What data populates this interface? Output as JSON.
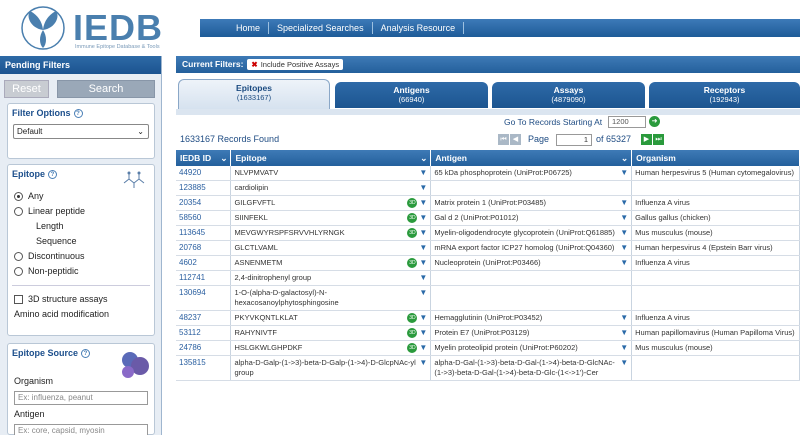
{
  "logo": {
    "title": "IEDB",
    "subtitle": "Immune Epitope Database & Tools"
  },
  "topnav": [
    "Home",
    "Specialized Searches",
    "Analysis Resource"
  ],
  "sidebar": {
    "header": "Pending Filters",
    "reset_label": "Reset",
    "search_label": "Search",
    "filter_options": {
      "title": "Filter Options",
      "selected": "Default"
    },
    "epitope": {
      "title": "Epitope",
      "options": [
        "Any",
        "Linear peptide",
        "Length",
        "Sequence",
        "Discontinuous",
        "Non-peptidic"
      ],
      "structure_checkbox": "3D structure assays",
      "amino_acid": "Amino acid modification"
    },
    "epitope_source": {
      "title": "Epitope Source",
      "organism_label": "Organism",
      "organism_placeholder": "Ex: influenza, peanut",
      "antigen_label": "Antigen",
      "antigen_placeholder": "Ex: core, capsid, myosin"
    }
  },
  "main": {
    "current_filters_label": "Current Filters:",
    "filter_chip": "Include Positive Assays",
    "tabs": [
      {
        "label": "Epitopes",
        "count": "(1633167)"
      },
      {
        "label": "Antigens",
        "count": "(66940)"
      },
      {
        "label": "Assays",
        "count": "(4879090)"
      },
      {
        "label": "Receptors",
        "count": "(192943)"
      }
    ],
    "goto_label": "Go To Records Starting At",
    "goto_value": "1200",
    "records_found": "1633167 Records Found",
    "page_label": "Page",
    "page_value": "1",
    "page_of": "of 65327",
    "columns": [
      "IEDB ID",
      "Epitope",
      "Antigen",
      "Organism"
    ],
    "rows": [
      {
        "id": "44920",
        "epitope": "NLVPMVATV",
        "antigen": "65 kDa phosphoprotein (UniProt:P06725)",
        "organism": "Human herpesvirus 5 (Human cytomegalovirus)",
        "has3d": false
      },
      {
        "id": "123885",
        "epitope": "cardiolipin",
        "antigen": "",
        "organism": "",
        "has3d": false
      },
      {
        "id": "20354",
        "epitope": "GILGFVFTL",
        "antigen": "Matrix protein 1 (UniProt:P03485)",
        "organism": "Influenza A virus",
        "has3d": true
      },
      {
        "id": "58560",
        "epitope": "SIINFEKL",
        "antigen": "Gal d 2 (UniProt:P01012)",
        "organism": "Gallus gallus (chicken)",
        "has3d": true
      },
      {
        "id": "113645",
        "epitope": "MEVGWYRSPFSRVVHLYRNGK",
        "antigen": "Myelin-oligodendrocyte glycoprotein (UniProt:Q61885)",
        "organism": "Mus musculus (mouse)",
        "has3d": true
      },
      {
        "id": "20768",
        "epitope": "GLCTLVAML",
        "antigen": "mRNA export factor ICP27 homolog (UniProt:Q04360)",
        "organism": "Human herpesvirus 4 (Epstein Barr virus)",
        "has3d": false
      },
      {
        "id": "4602",
        "epitope": "ASNENMETM",
        "antigen": "Nucleoprotein (UniProt:P03466)",
        "organism": "Influenza A virus",
        "has3d": true
      },
      {
        "id": "112741",
        "epitope": "2,4-dinitrophenyl group",
        "antigen": "",
        "organism": "",
        "has3d": false
      },
      {
        "id": "130694",
        "epitope": "1-O-(alpha-D-galactosyl)-N-hexacosanoylphytosphingosine",
        "antigen": "",
        "organism": "",
        "has3d": false
      },
      {
        "id": "48237",
        "epitope": "PKYVKQNTLKLAT",
        "antigen": "Hemagglutinin (UniProt:P03452)",
        "organism": "Influenza A virus",
        "has3d": true
      },
      {
        "id": "53112",
        "epitope": "RAHYNIVTF",
        "antigen": "Protein E7 (UniProt:P03129)",
        "organism": "Human papillomavirus (Human Papilloma Virus)",
        "has3d": true
      },
      {
        "id": "24786",
        "epitope": "HSLGKWLGHPDKF",
        "antigen": "Myelin proteolipid protein (UniProt:P60202)",
        "organism": "Mus musculus (mouse)",
        "has3d": true
      },
      {
        "id": "135815",
        "epitope": "alpha-D-Galp-(1->3)-beta-D-Galp-(1->4)-D-GlcpNAc-yl group",
        "antigen": "alpha-D-Gal-(1->3)-beta-D-Gal-(1->4)-beta-D-GlcNAc-(1->3)-beta-D-Gal-(1->4)-beta-D-Glc-(1<->1')-Cer",
        "organism": "",
        "has3d": false
      }
    ]
  }
}
